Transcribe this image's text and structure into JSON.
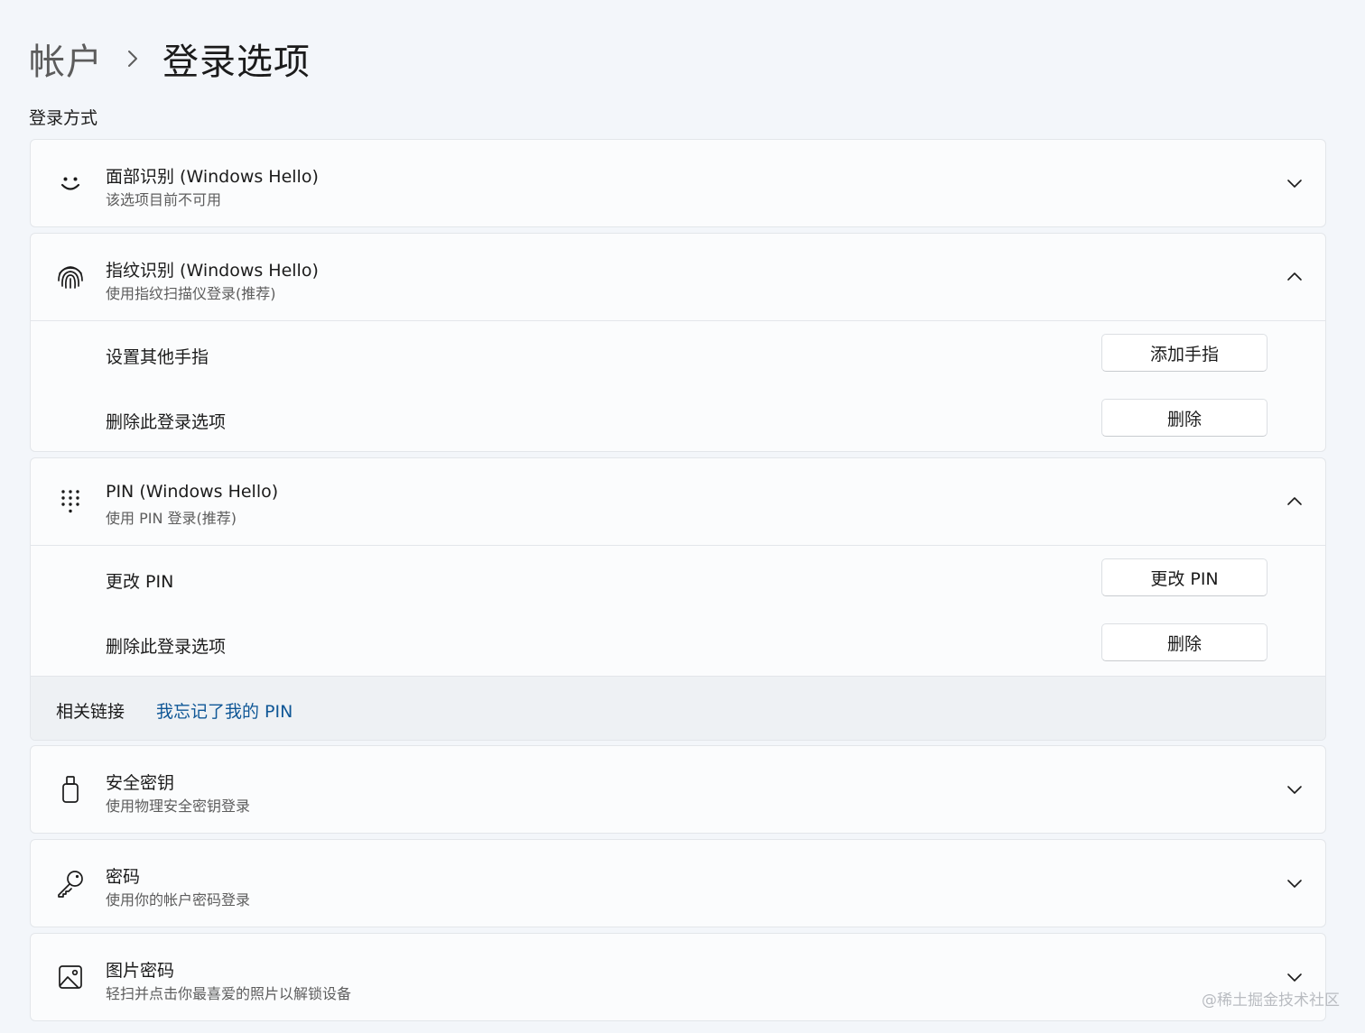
{
  "breadcrumb": {
    "parent": "帐户",
    "separator_icon": "chevron-right-icon",
    "current": "登录选项"
  },
  "section_title": "登录方式",
  "options": {
    "face": {
      "icon": "face-smile-icon",
      "title": "面部识别 (Windows Hello)",
      "subtitle": "该选项目前不可用",
      "expanded": false
    },
    "fingerprint": {
      "icon": "fingerprint-icon",
      "title": "指纹识别 (Windows Hello)",
      "subtitle": "使用指纹扫描仪登录(推荐)",
      "expanded": true,
      "rows": [
        {
          "label": "设置其他手指",
          "button": "添加手指"
        },
        {
          "label": "删除此登录选项",
          "button": "删除"
        }
      ]
    },
    "pin": {
      "icon": "keypad-icon",
      "title": "PIN (Windows Hello)",
      "subtitle": "使用 PIN 登录(推荐)",
      "expanded": true,
      "rows": [
        {
          "label": "更改 PIN",
          "button": "更改 PIN"
        },
        {
          "label": "删除此登录选项",
          "button": "删除"
        }
      ],
      "related_label": "相关链接",
      "related_link": "我忘记了我的 PIN"
    },
    "security_key": {
      "icon": "usb-key-icon",
      "title": "安全密钥",
      "subtitle": "使用物理安全密钥登录",
      "expanded": false
    },
    "password": {
      "icon": "key-icon",
      "title": "密码",
      "subtitle": "使用你的帐户密码登录",
      "expanded": false
    },
    "picture_password": {
      "icon": "image-icon",
      "title": "图片密码",
      "subtitle": "轻扫并点击你最喜爱的照片以解锁设备",
      "expanded": false
    }
  },
  "watermark": "@稀土掘金技术社区",
  "colors": {
    "background": "#f3f6fa",
    "card": "#fbfcfd",
    "link": "#0f5796",
    "related_background": "#eef1f4"
  }
}
